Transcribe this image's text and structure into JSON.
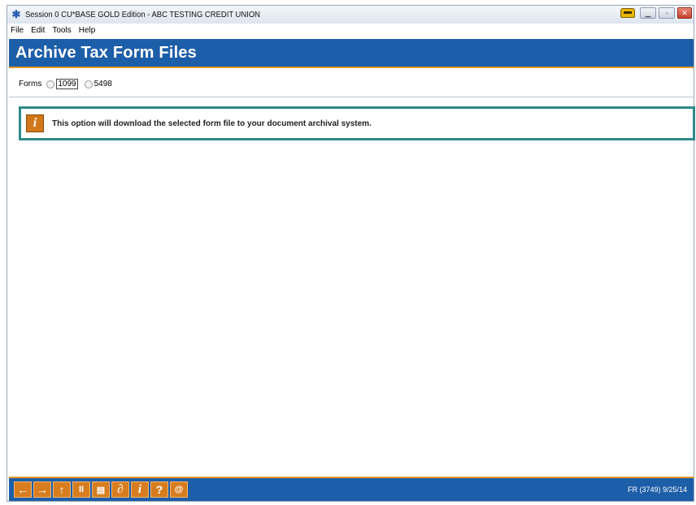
{
  "window": {
    "title": "Session 0 CU*BASE GOLD Edition - ABC TESTING CREDIT UNION",
    "icon": "asterisk-app-icon"
  },
  "menu": {
    "items": [
      "File",
      "Edit",
      "Tools",
      "Help"
    ]
  },
  "header": {
    "title": "Archive Tax Form Files"
  },
  "forms": {
    "label": "Forms",
    "options": [
      {
        "label": "1099",
        "selected": false
      },
      {
        "label": "5498",
        "selected": false
      }
    ]
  },
  "info": {
    "icon": "info-icon",
    "message": "This option will download the selected form file to your document archival system."
  },
  "footer": {
    "buttons": [
      {
        "name": "back-arrow-icon",
        "glyph": "←"
      },
      {
        "name": "forward-arrow-icon",
        "glyph": "→"
      },
      {
        "name": "up-arrow-icon",
        "glyph": "↑"
      },
      {
        "name": "pause-icon",
        "glyph": "II"
      },
      {
        "name": "print-icon",
        "glyph": "▤"
      },
      {
        "name": "link-icon",
        "glyph": "∂"
      },
      {
        "name": "info-icon",
        "glyph": "i"
      },
      {
        "name": "help-icon",
        "glyph": "?"
      },
      {
        "name": "at-icon",
        "glyph": "@"
      }
    ],
    "screen_code": "FR (3749) 9/25/14"
  },
  "colors": {
    "header_blue": "#1d5ea8",
    "accent_orange": "#d77d1f",
    "info_border": "#2e8a8a"
  }
}
